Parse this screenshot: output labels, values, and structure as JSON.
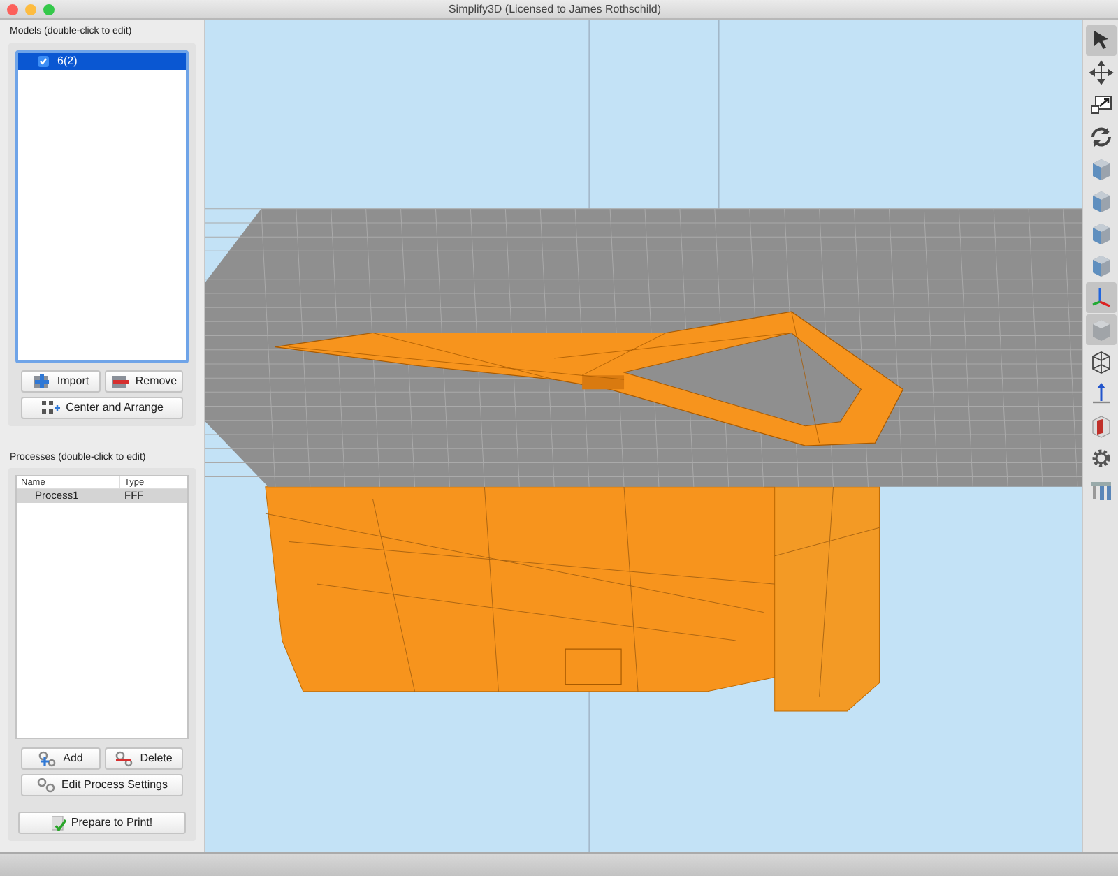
{
  "window": {
    "title": "Simplify3D (Licensed to James Rothschild)"
  },
  "models": {
    "label": "Models (double-click to edit)",
    "items": [
      {
        "label": "6(2)",
        "checked": true,
        "selected": true
      }
    ],
    "buttons": [
      {
        "kind": "import",
        "label": "Import"
      },
      {
        "kind": "remove",
        "label": "Remove"
      },
      {
        "kind": "arrange",
        "label": "Center and Arrange"
      }
    ]
  },
  "processes": {
    "label": "Processes (double-click to edit)",
    "columns": [
      "Name",
      "Type"
    ],
    "rows": [
      {
        "name": "Process1",
        "type": "FFF",
        "selected": true
      }
    ],
    "buttons": [
      {
        "kind": "add",
        "label": "Add"
      },
      {
        "kind": "delete",
        "label": "Delete"
      },
      {
        "kind": "settings",
        "label": "Edit Process Settings"
      }
    ]
  },
  "prepare_button": {
    "label": "Prepare to Print!"
  },
  "toolbar": [
    {
      "kind": "pointer",
      "selected": true
    },
    {
      "kind": "move",
      "selected": false
    },
    {
      "kind": "scale",
      "selected": false
    },
    {
      "kind": "rotate",
      "selected": false
    },
    {
      "kind": "view",
      "selected": false
    },
    {
      "kind": "view",
      "selected": false
    },
    {
      "kind": "view",
      "selected": false
    },
    {
      "kind": "view",
      "selected": false
    },
    {
      "kind": "axes",
      "selected": true
    },
    {
      "kind": "solid",
      "selected": true
    },
    {
      "kind": "wireframe",
      "selected": false
    },
    {
      "kind": "normal",
      "selected": false
    },
    {
      "kind": "section",
      "selected": false
    },
    {
      "kind": "settings",
      "selected": false
    },
    {
      "kind": "supports",
      "selected": false
    }
  ]
}
